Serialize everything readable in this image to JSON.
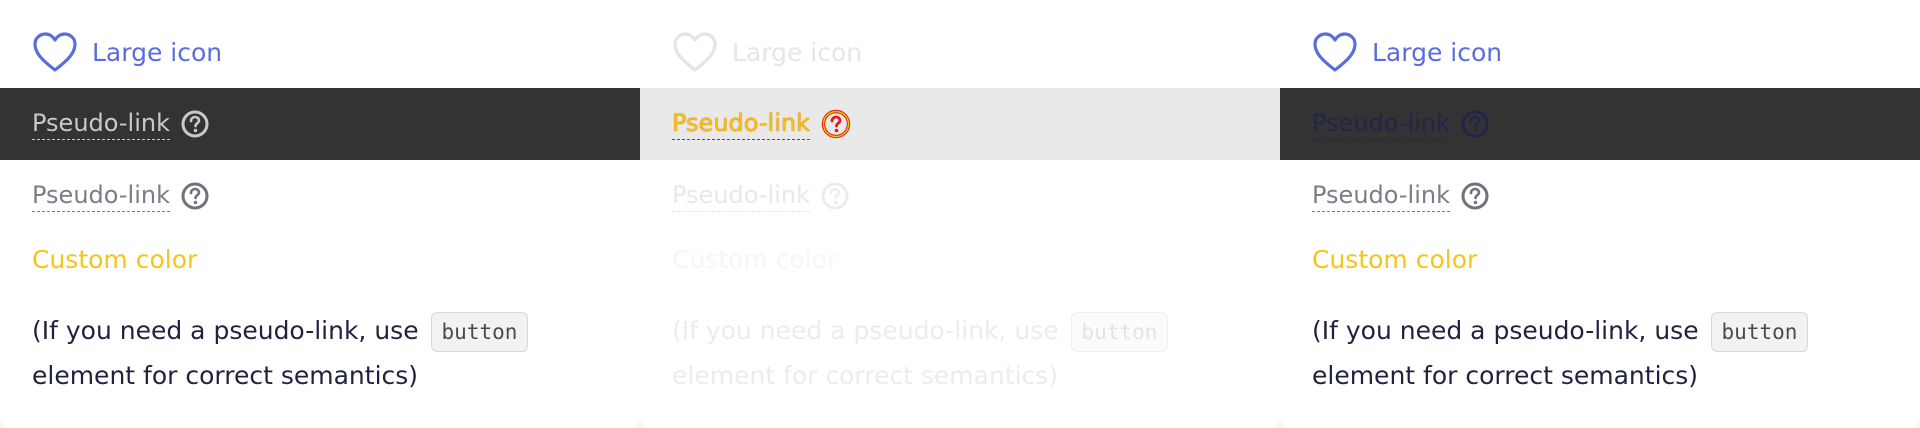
{
  "panels": [
    {
      "large_icon_label": "Large icon",
      "band_link_label": "Pseudo-link",
      "plain_link_label": "Pseudo-link",
      "custom_color_label": "Custom color",
      "note_before": "(If you need a pseudo-link, use",
      "note_code": "button",
      "note_after": "element for correct semantics)"
    },
    {
      "large_icon_label": "Large icon",
      "band_link_label": "Pseudo-link",
      "plain_link_label": "Pseudo-link",
      "custom_color_label": "Custom color",
      "note_before": "(If you need a pseudo-link, use",
      "note_code": "button",
      "note_after": "element for correct semantics)"
    },
    {
      "large_icon_label": "Large icon",
      "band_link_label": "Pseudo-link",
      "plain_link_label": "Pseudo-link",
      "custom_color_label": "Custom color",
      "note_before": "(If you need a pseudo-link, use",
      "note_code": "button",
      "note_after": "element for correct semantics)"
    }
  ],
  "icons": {
    "large": "heart-icon",
    "hint": "question-circle-icon"
  },
  "colors": {
    "link_blue": "#5b6cdc",
    "custom_yellow": "#f5c518",
    "dark_band": "#333333",
    "light_band": "#e9e9e9",
    "hover_outline_red": "#e31b1b"
  }
}
